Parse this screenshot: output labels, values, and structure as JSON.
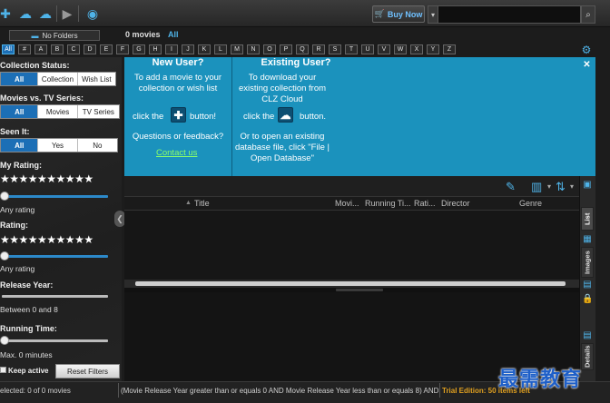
{
  "toolbar": {
    "buy_now_label": "Buy Now",
    "search_placeholder": ""
  },
  "folders": {
    "button_label": "No Folders",
    "movie_count": "0 movies",
    "filter_label": "All"
  },
  "letters": [
    "All",
    "#",
    "A",
    "B",
    "C",
    "D",
    "E",
    "F",
    "G",
    "H",
    "I",
    "J",
    "K",
    "L",
    "M",
    "N",
    "O",
    "P",
    "Q",
    "R",
    "S",
    "T",
    "U",
    "V",
    "W",
    "X",
    "Y",
    "Z"
  ],
  "sidebar": {
    "collection_status": {
      "label": "Collection Status:",
      "options": [
        "All",
        "Collection",
        "Wish List"
      ],
      "selected": "All"
    },
    "movies_vs_tv": {
      "label": "Movies vs. TV Series:",
      "options": [
        "All",
        "Movies",
        "TV Series"
      ],
      "selected": "All"
    },
    "seen_it": {
      "label": "Seen It:",
      "options": [
        "All",
        "Yes",
        "No"
      ],
      "selected": "All"
    },
    "my_rating": {
      "label": "My Rating:",
      "stars": "★★★★★★★★★★",
      "value_text": "Any rating",
      "level": 0
    },
    "rating": {
      "label": "Rating:",
      "stars": "★★★★★★★★★★",
      "value_text": "Any rating",
      "level": 0
    },
    "release_year": {
      "label": "Release Year:",
      "value_text": "Between 0 and 8"
    },
    "running_time": {
      "label": "Running Time:",
      "value_text": "Max. 0 minutes",
      "level": 0
    },
    "keep_active_label": "Keep active",
    "reset_label": "Reset Filters"
  },
  "welcome": {
    "new_user_title": "New User?",
    "new_user_text1": "To add a movie to your collection or wish list",
    "click_the": "click the",
    "button_word": "button!",
    "questions": "Questions or feedback?",
    "contact": "Contact us",
    "existing_title": "Existing User?",
    "existing_text1": "To download your existing collection from CLZ Cloud",
    "existing_click": "click the",
    "existing_button_word": "button.",
    "existing_text2": "Or to open an existing database file, click \"File | Open Database\""
  },
  "columns": [
    "Title",
    "Movi...",
    "Running Ti...",
    "Rati...",
    "Director",
    "Genre"
  ],
  "right_tabs": [
    "List",
    "Images",
    "Details"
  ],
  "status": {
    "selected": "elected: 0 of 0 movies",
    "query": "(Movie Release Year greater than or equals 0 AND Movie Release Year less than or equals 8) AND R",
    "trial": "Trial Edition: 50 items left"
  },
  "watermark": "最需教育",
  "colors": {
    "accent": "#1c6fb6",
    "welcome_bg": "#1b92bd",
    "link": "#8bff6a",
    "trial": "#e0a020"
  }
}
